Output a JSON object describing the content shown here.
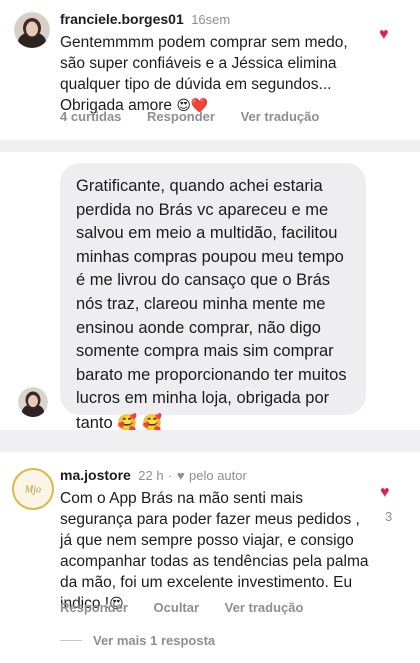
{
  "comment1": {
    "username": "franciele.borges01",
    "time": "16sem",
    "text": "Gentemmmm podem comprar sem medo, são super confiáveis e a Jéssica elimina qualquer tipo de dúvida em segundos... Obrigada amore",
    "emojis": "😍❤️",
    "likes": "4 curtidas",
    "reply": "Responder",
    "translate": "Ver tradução"
  },
  "message": {
    "text": "Gratificante, quando achei estaria perdida no Brás vc apareceu e me salvou em meio a multidão, facilitou minhas compras poupou meu tempo é me livrou do cansaço que o Brás nós traz, clareou minha mente me ensinou aonde comprar, não digo somente compra mais sim comprar barato me proporcionando ter muitos lucros em minha loja, obrigada por tanto",
    "emojis": "🥰 🥰"
  },
  "comment2": {
    "username": "ma.jostore",
    "time": "22 h",
    "separator": "·",
    "by_author": "pelo autor",
    "text": "Com o App Brás na mão senti mais segurança para poder fazer meus pedidos , já que nem sempre posso viajar, e consigo acompanhar todas as tendências  pela palma da mão, foi um excelente investimento. Eu indico !",
    "emojis": "😍",
    "like_count": "3",
    "reply": "Responder",
    "hide": "Ocultar",
    "translate": "Ver tradução",
    "more_replies": "Ver mais 1 resposta",
    "avatar_text": "Mjo"
  },
  "icons": {
    "heart": "heart-icon",
    "heart_char": "♥"
  },
  "colors": {
    "heart": "#e0234e",
    "muted": "#8e8e93",
    "bubble": "#eeeef0",
    "separator": "#f0f0f2"
  }
}
